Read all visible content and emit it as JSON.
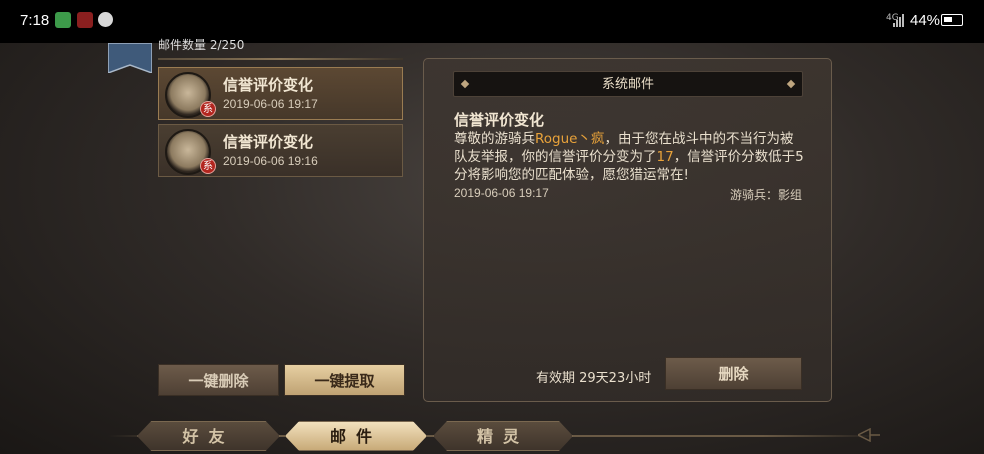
{
  "status_bar": {
    "time": "7:18",
    "network": "4G",
    "battery": "44%"
  },
  "mail_list": {
    "count_label": "邮件数量 2/250",
    "items": [
      {
        "title": "信誉评价变化",
        "date": "2019-06-06 19:17",
        "badge": "系",
        "selected": true
      },
      {
        "title": "信誉评价变化",
        "date": "2019-06-06 19:16",
        "badge": "系",
        "selected": false
      }
    ],
    "delete_all_label": "一键删除",
    "collect_all_label": "一键提取"
  },
  "mail_detail": {
    "header": "系统邮件",
    "title": "信誉评价变化",
    "body_part1": "尊敬的游骑兵",
    "body_name": "Rogue丶疯",
    "body_part2": "，由于您在战斗中的不当行为被队友举报，你的信誉评价分变为了",
    "body_score": "17",
    "body_part3": "，信誉评价分数低于5分将影响您的匹配体验，愿您猎运常在!",
    "date": "2019-06-06 19:17",
    "sender": "游骑兵：影组",
    "validity": "有效期  29天23小时",
    "delete_label": "删除"
  },
  "tabs": {
    "friends": "好友",
    "mail": "邮件",
    "spirits": "精灵"
  },
  "colors": {
    "highlight": "#e8a23a",
    "badge": "#b2261f"
  }
}
